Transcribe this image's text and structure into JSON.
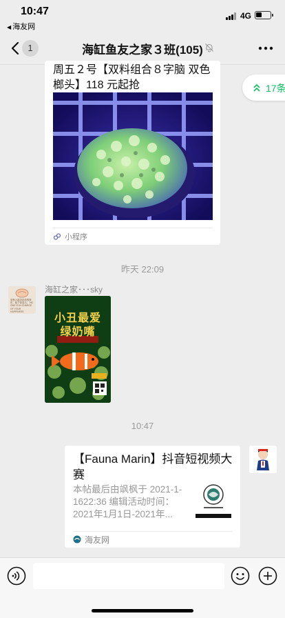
{
  "status_bar": {
    "time": "10:47",
    "back_app": "海友网",
    "network": "4G"
  },
  "nav": {
    "badge_count": "1",
    "title": "海缸鱼友之家３班(105)",
    "icons": [
      "chevron-left-icon",
      "mute-bell-icon",
      "more-icon"
    ]
  },
  "unread_pill": {
    "label": "17条"
  },
  "messages": {
    "mini_program_card": {
      "title": "周五２号【双料组合８字脑 双色榔头】118 元起抢",
      "footer": "小程序"
    },
    "timestamp_yesterday": "昨天 22:09",
    "sender_name": "海缸之家･･･sky",
    "sender_avatar_text": "没有人能决定你的快乐，除了你自己。 NO ONE IS IN CHARGE OF YOUR HAPPINESS",
    "poster": {
      "line1": "小丑最爱",
      "line2": "绿奶嘴"
    },
    "timestamp_today": "10:47",
    "link_card": {
      "title": "【Fauna Marin】抖音短视频大赛",
      "description": "本帖最后由飒枫于 2021-1-1622:36 编辑活动时间：2021年1月1日-2021年...",
      "footer": "海友网"
    }
  },
  "input_bar": {
    "placeholder": "",
    "icons": [
      "voice-icon",
      "emoji-icon",
      "plus-icon"
    ]
  },
  "colors": {
    "accent_green": "#07c160",
    "background": "#ededed"
  }
}
